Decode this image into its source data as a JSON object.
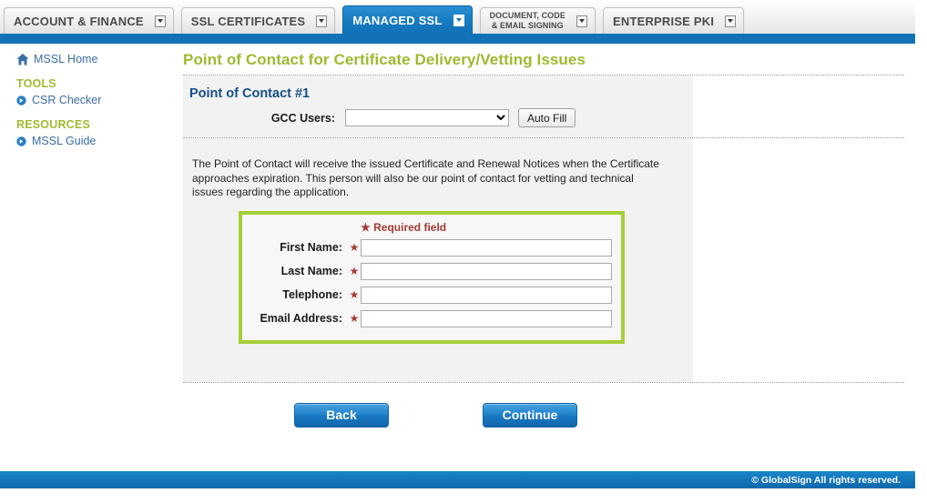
{
  "tabs": [
    {
      "label": "ACCOUNT & FINANCE",
      "active": false,
      "two_line": false,
      "icon": "dropdown-arrow-icon"
    },
    {
      "label": "SSL CERTIFICATES",
      "active": false,
      "two_line": false,
      "icon": "dropdown-arrow-icon"
    },
    {
      "label": "MANAGED SSL",
      "active": true,
      "two_line": false,
      "icon": "dropdown-arrow-icon"
    },
    {
      "label": "DOCUMENT, CODE\n& EMAIL SIGNING",
      "active": false,
      "two_line": true,
      "icon": "dropdown-arrow-icon"
    },
    {
      "label": "ENTERPRISE PKI",
      "active": false,
      "two_line": false,
      "icon": "dropdown-arrow-icon"
    }
  ],
  "sidebar": {
    "home": {
      "label": "MSSL Home",
      "icon": "home-icon"
    },
    "groups": [
      {
        "heading": "TOOLS",
        "items": [
          {
            "label": "CSR Checker",
            "icon": "arrow-circle-icon"
          }
        ]
      },
      {
        "heading": "RESOURCES",
        "items": [
          {
            "label": "MSSL Guide",
            "icon": "arrow-circle-icon"
          }
        ]
      }
    ]
  },
  "page": {
    "title": "Point of Contact for Certificate Delivery/Vetting Issues",
    "section_title": "Point of Contact #1",
    "gcc_label": "GCC Users:",
    "gcc_value": "",
    "gcc_options": [
      ""
    ],
    "autofill_label": "Auto Fill",
    "description": "The Point of Contact will receive the issued Certificate and Renewal Notices when the Certificate approaches expiration. This person will also be our point of contact for vetting and technical issues regarding the application.",
    "required_note": "Required field",
    "required_star": "★",
    "fields": [
      {
        "label": "First Name:",
        "star": "★",
        "value": "",
        "placeholder": ""
      },
      {
        "label": "Last Name:",
        "star": "★",
        "value": "",
        "placeholder": ""
      },
      {
        "label": "Telephone:",
        "star": "★",
        "value": "",
        "placeholder": ""
      },
      {
        "label": "Email Address:",
        "star": "★",
        "value": "",
        "placeholder": ""
      }
    ],
    "back_label": "Back",
    "continue_label": "Continue"
  },
  "footer": {
    "copyright": "© GlobalSign All rights reserved."
  },
  "colors": {
    "brand_blue": "#1272b8",
    "title_green": "#9cba2e",
    "box_green": "#a6ce39",
    "heading_olive": "#a2b830",
    "section_blue": "#174f86",
    "required_red": "#a33a33",
    "panel_gray": "#f2f2f2"
  }
}
